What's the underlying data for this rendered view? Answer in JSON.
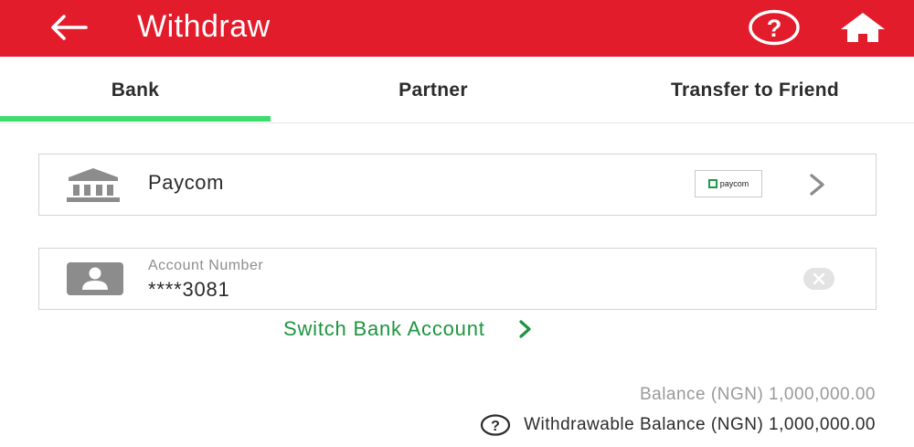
{
  "header": {
    "title": "Withdraw",
    "bg_color": "#e31c2c",
    "back_icon": "arrow-left-icon",
    "help_icon": "help-circle-icon",
    "home_icon": "home-icon"
  },
  "tabs": [
    {
      "label": "Bank",
      "active": true
    },
    {
      "label": "Partner",
      "active": false
    },
    {
      "label": "Transfer to Friend",
      "active": false
    }
  ],
  "accent_color": "#3ddc6e",
  "bank_selector": {
    "bank_name": "Paycom",
    "logo_text": "paycom",
    "bank_icon": "bank-building-icon",
    "chevron_icon": "chevron-right-icon"
  },
  "account_field": {
    "label": "Account Number",
    "value": "****3081",
    "person_icon": "account-card-icon",
    "clear_icon": "clear-icon"
  },
  "switch_account": {
    "label": "Switch Bank Account",
    "color": "#1e9440",
    "chevron_icon": "chevron-right-icon"
  },
  "balance": {
    "balance_text": "Balance (NGN) 1,000,000.00",
    "withdrawable_text": "Withdrawable Balance (NGN) 1,000,000.00",
    "help_icon": "help-circle-icon"
  }
}
